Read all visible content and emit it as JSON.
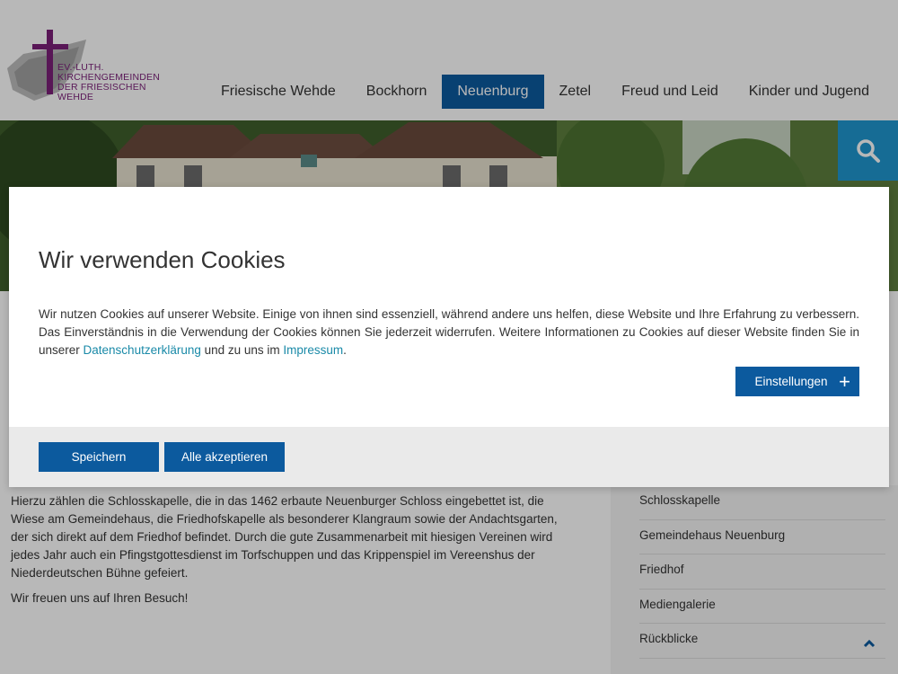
{
  "logo": {
    "line1": "EV.-LUTH.",
    "line2": "KIRCHENGEMEINDEN",
    "line3": "DER FRIESISCHEN WEHDE",
    "icon": "purple-cross-logo-icon"
  },
  "nav": {
    "items": [
      "Friesische Wehde",
      "Bockhorn",
      "Neuenburg",
      "Zetel",
      "Freud und Leid",
      "Kinder und Jugend"
    ],
    "active": "Neuenburg"
  },
  "search": {
    "icon": "search-icon"
  },
  "main": {
    "paragraph1": "Hierzu zählen die Schlosskapelle, die in das 1462 erbaute Neuenburger Schloss eingebettet ist, die Wiese am Gemeindehaus, die Friedhofskapelle als besonderer Klangraum sowie der Andachtsgarten, der sich direkt auf dem Friedhof befindet. Durch die gute Zusammenarbeit mit hiesigen Vereinen wird jedes Jahr auch ein Pfingstgottesdienst im Torfschuppen und das Krippenspiel im Vereenshus der Niederdeutschen Bühne gefeiert.",
    "paragraph2": "Wir freuen uns auf Ihren Besuch!"
  },
  "sidebar": {
    "items": [
      "Schlosskapelle",
      "Gemeindehaus Neuenburg",
      "Friedhof",
      "Mediengalerie",
      "Rückblicke"
    ]
  },
  "cookie_modal": {
    "title": "Wir verwenden Cookies",
    "text_before": "Wir nutzen Cookies auf unserer Website. Einige von ihnen sind essenziell, während andere uns helfen, diese Website und Ihre Erfahrung zu verbessern. Das Einverständnis in die Verwendung der Cookies können Sie jederzeit widerrufen. Weitere Informationen zu Cookies auf dieser Website finden Sie in unserer ",
    "privacy_link": "Datenschutzerklärung",
    "text_middle": " und zu uns im ",
    "imprint_link": "Impressum",
    "text_after": ".",
    "settings_label": "Einstellungen",
    "save_label": "Speichern",
    "accept_all_label": "Alle akzeptieren"
  },
  "colors": {
    "primary": "#0c5a9e",
    "search_bg": "#1f96cf",
    "link": "#1a8aa8",
    "logo_purple": "#7a1f78"
  }
}
